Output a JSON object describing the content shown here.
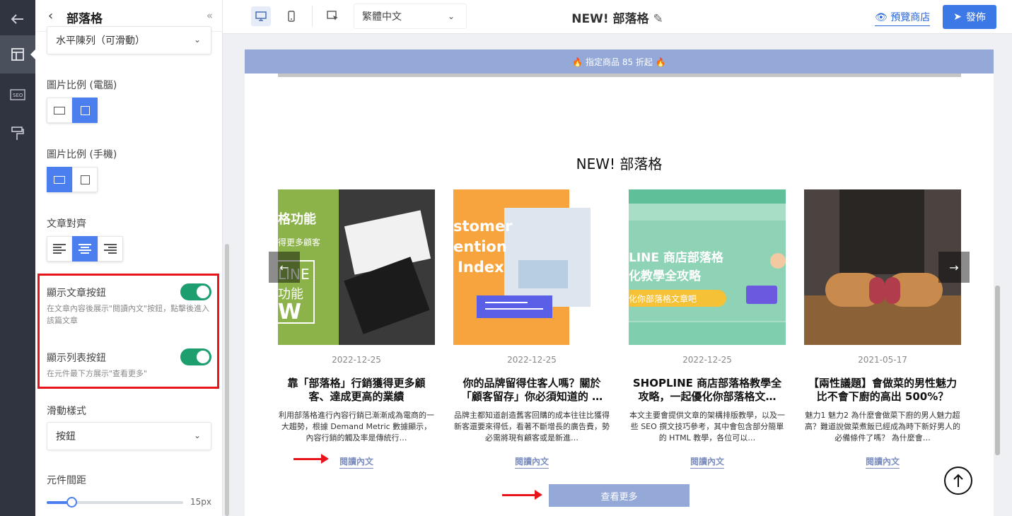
{
  "rail": {
    "icons": [
      "back-arrow-icon",
      "layout-icon",
      "seo-icon",
      "paint-roller-icon"
    ],
    "seo_text": "SEO"
  },
  "panel": {
    "title": "部落格",
    "layout_select": "水平陳列（可滑動）",
    "ratio_desktop_label": "圖片比例 (電腦)",
    "ratio_mobile_label": "圖片比例 (手機)",
    "align_label": "文章對齊",
    "show_read_button": {
      "label": "顯示文章按鈕",
      "desc": "在文章內容後展示\"閱讀內文\"按鈕，點擊後進入該篇文章",
      "on": true
    },
    "show_list_button": {
      "label": "顯示列表按鈕",
      "desc": "在元件最下方展示\"查看更多\"",
      "on": true
    },
    "slide_style_label": "滑動樣式",
    "slide_style_value": "按鈕",
    "spacing_label": "元件間距",
    "spacing_value": "15px",
    "spacing_level": 0.15
  },
  "topbar": {
    "language": "繁體中文",
    "page_title": "NEW! 部落格",
    "preview": "預覽商店",
    "publish": "發佈"
  },
  "canvas": {
    "banner": "🔥 指定商品 85 折起 🔥",
    "section_title": "NEW! 部落格",
    "posts": [
      {
        "date": "2022-12-25",
        "title": "靠「部落格」行銷獲得更多顧客、達成更高的業績",
        "desc": "利用部落格進行內容行銷已漸漸成為電商的一大趨勢，根據 Demand Metric 數據顯示，內容行銷的觸及率是傳統行…",
        "read": "閱讀內文",
        "img_text": [
          "格功能",
          "得更多顧客",
          "LINE",
          "功能",
          "W"
        ]
      },
      {
        "date": "2022-12-25",
        "title": "你的品牌留得住客人嗎？關於「顧客留存」你必須知道的 …",
        "desc": "品牌主都知道創造舊客回購的成本往往比獲得新客還要來得低，看著不斷增長的廣告費，勢必需將現有顧客或是新進…",
        "read": "閱讀內文",
        "img_text": [
          "stomer",
          "ention",
          "Index"
        ]
      },
      {
        "date": "2022-12-25",
        "title": "SHOPLINE 商店部落格教學全攻略，一起優化你部落格文…",
        "desc": "本文主要會提供文章的架構排版教學，以及一些 SEO 撰文技巧參考，其中會包含部分簡單的 HTML 教學，各位可以…",
        "read": "閱讀內文",
        "img_text": [
          "LINE 商店部落格",
          "化教學全攻略",
          "化你部落格文章吧"
        ]
      },
      {
        "date": "2021-05-17",
        "title": "【兩性議題】會做菜的男性魅力比不會下廚的高出 500%？",
        "desc": "魅力1 魅力2 為什麼會做菜下廚的男人魅力超高？難道說做菜煮飯已經成為時下新好男人的必備條件了嗎？ 為什麼會…",
        "read": "閱讀內文",
        "img_text": []
      }
    ],
    "view_more": "查看更多"
  },
  "colors": {
    "accent": "#4b7ff0",
    "toggle_on": "#1d9e6f",
    "highlight": "#e8141b",
    "banner": "#94a9d8",
    "rail": "#2f3440",
    "link": "#7d8fc1"
  }
}
